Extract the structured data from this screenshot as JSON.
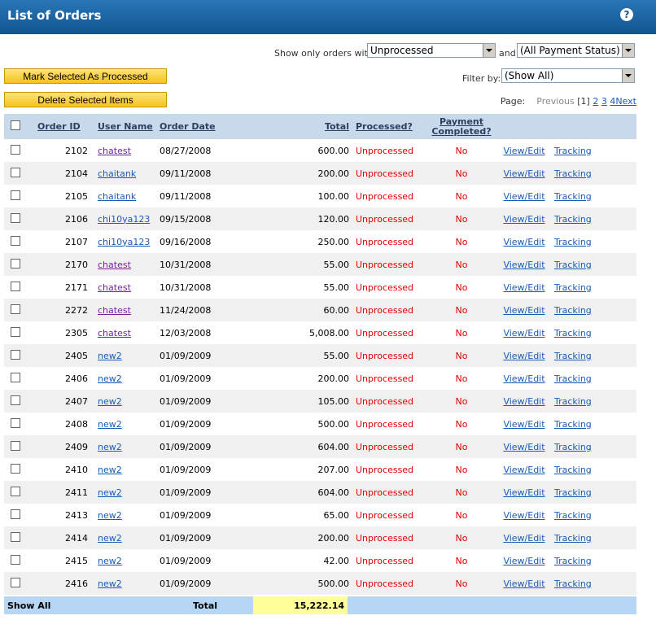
{
  "title": "List of Orders",
  "help_icon": "?",
  "filters": {
    "show_only_label": "Show only orders with:",
    "processed_select": "Unprocessed",
    "and_label": "and",
    "payment_select": "(All Payment Status)",
    "filter_by_label": "Filter by:",
    "filter_by_select": "(Show All)"
  },
  "buttons": {
    "mark_processed": "Mark Selected As Processed",
    "delete_selected": "Delete Selected Items"
  },
  "pager": {
    "label": "Page:",
    "previous": "Previous",
    "current": "[1]",
    "pages": [
      "2",
      "3",
      "4"
    ],
    "next": "Next"
  },
  "columns": {
    "order_id": "Order ID",
    "user_name": "User Name",
    "order_date": "Order Date",
    "total": "Total",
    "processed": "Processed?",
    "payment_line1": "Payment",
    "payment_line2": "Completed?"
  },
  "orders": [
    {
      "id": "2102",
      "user": "chatest",
      "date": "08/27/2008",
      "total": "600.00",
      "processed": "Unprocessed",
      "payment": "No",
      "view": "View/Edit",
      "tracking": "Tracking"
    },
    {
      "id": "2104",
      "user": "chaitank",
      "date": "09/11/2008",
      "total": "200.00",
      "processed": "Unprocessed",
      "payment": "No",
      "view": "View/Edit",
      "tracking": "Tracking"
    },
    {
      "id": "2105",
      "user": "chaitank",
      "date": "09/11/2008",
      "total": "100.00",
      "processed": "Unprocessed",
      "payment": "No",
      "view": "View/Edit",
      "tracking": "Tracking"
    },
    {
      "id": "2106",
      "user": "chi10ya123",
      "date": "09/15/2008",
      "total": "120.00",
      "processed": "Unprocessed",
      "payment": "No",
      "view": "View/Edit",
      "tracking": "Tracking"
    },
    {
      "id": "2107",
      "user": "chi10ya123",
      "date": "09/16/2008",
      "total": "250.00",
      "processed": "Unprocessed",
      "payment": "No",
      "view": "View/Edit",
      "tracking": "Tracking"
    },
    {
      "id": "2170",
      "user": "chatest",
      "date": "10/31/2008",
      "total": "55.00",
      "processed": "Unprocessed",
      "payment": "No",
      "view": "View/Edit",
      "tracking": "Tracking"
    },
    {
      "id": "2171",
      "user": "chatest",
      "date": "10/31/2008",
      "total": "55.00",
      "processed": "Unprocessed",
      "payment": "No",
      "view": "View/Edit",
      "tracking": "Tracking"
    },
    {
      "id": "2272",
      "user": "chatest",
      "date": "11/24/2008",
      "total": "60.00",
      "processed": "Unprocessed",
      "payment": "No",
      "view": "View/Edit",
      "tracking": "Tracking"
    },
    {
      "id": "2305",
      "user": "chatest",
      "date": "12/03/2008",
      "total": "5,008.00",
      "processed": "Unprocessed",
      "payment": "No",
      "view": "View/Edit",
      "tracking": "Tracking"
    },
    {
      "id": "2405",
      "user": "new2",
      "date": "01/09/2009",
      "total": "55.00",
      "processed": "Unprocessed",
      "payment": "No",
      "view": "View/Edit",
      "tracking": "Tracking"
    },
    {
      "id": "2406",
      "user": "new2",
      "date": "01/09/2009",
      "total": "200.00",
      "processed": "Unprocessed",
      "payment": "No",
      "view": "View/Edit",
      "tracking": "Tracking"
    },
    {
      "id": "2407",
      "user": "new2",
      "date": "01/09/2009",
      "total": "105.00",
      "processed": "Unprocessed",
      "payment": "No",
      "view": "View/Edit",
      "tracking": "Tracking"
    },
    {
      "id": "2408",
      "user": "new2",
      "date": "01/09/2009",
      "total": "500.00",
      "processed": "Unprocessed",
      "payment": "No",
      "view": "View/Edit",
      "tracking": "Tracking"
    },
    {
      "id": "2409",
      "user": "new2",
      "date": "01/09/2009",
      "total": "604.00",
      "processed": "Unprocessed",
      "payment": "No",
      "view": "View/Edit",
      "tracking": "Tracking"
    },
    {
      "id": "2410",
      "user": "new2",
      "date": "01/09/2009",
      "total": "207.00",
      "processed": "Unprocessed",
      "payment": "No",
      "view": "View/Edit",
      "tracking": "Tracking"
    },
    {
      "id": "2411",
      "user": "new2",
      "date": "01/09/2009",
      "total": "604.00",
      "processed": "Unprocessed",
      "payment": "No",
      "view": "View/Edit",
      "tracking": "Tracking"
    },
    {
      "id": "2413",
      "user": "new2",
      "date": "01/09/2009",
      "total": "65.00",
      "processed": "Unprocessed",
      "payment": "No",
      "view": "View/Edit",
      "tracking": "Tracking"
    },
    {
      "id": "2414",
      "user": "new2",
      "date": "01/09/2009",
      "total": "200.00",
      "processed": "Unprocessed",
      "payment": "No",
      "view": "View/Edit",
      "tracking": "Tracking"
    },
    {
      "id": "2415",
      "user": "new2",
      "date": "01/09/2009",
      "total": "42.00",
      "processed": "Unprocessed",
      "payment": "No",
      "view": "View/Edit",
      "tracking": "Tracking"
    },
    {
      "id": "2416",
      "user": "new2",
      "date": "01/09/2009",
      "total": "500.00",
      "processed": "Unprocessed",
      "payment": "No",
      "view": "View/Edit",
      "tracking": "Tracking"
    }
  ],
  "footer": {
    "show_all": "Show All",
    "total_label": "Total",
    "total_value": "15,222.14"
  },
  "colors": {
    "header_blue": "#11558f",
    "table_header": "#c8d9ec",
    "unprocessed_red": "#e40000",
    "button_yellow": "#f6c21e",
    "total_highlight": "#ffff99"
  }
}
